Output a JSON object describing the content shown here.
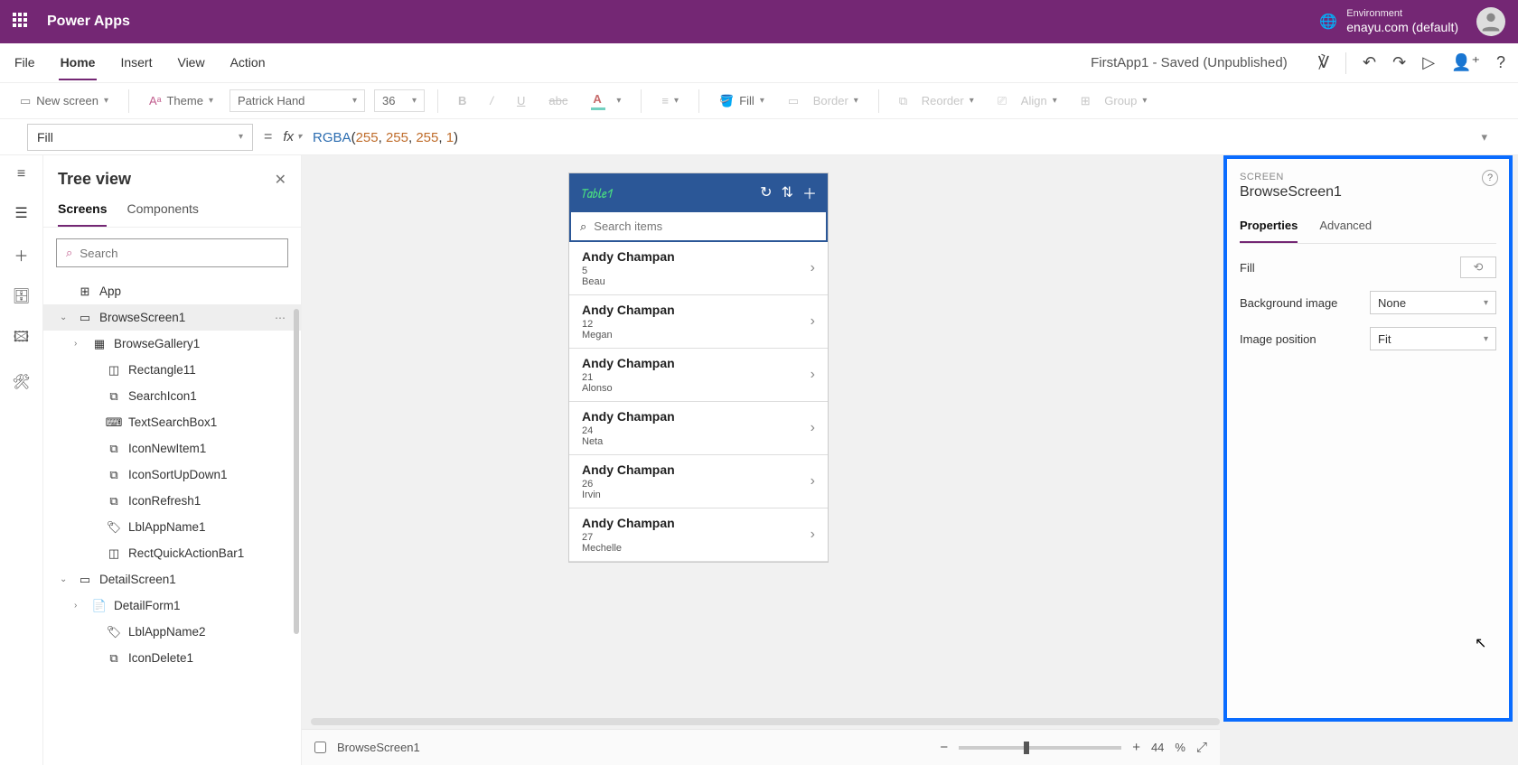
{
  "header": {
    "app": "Power Apps",
    "env_label": "Environment",
    "env_value": "enayu.com (default)"
  },
  "menu": {
    "items": [
      "File",
      "Home",
      "Insert",
      "View",
      "Action"
    ],
    "active": "Home",
    "status": "FirstApp1 - Saved (Unpublished)"
  },
  "ribbon": {
    "new_screen": "New screen",
    "theme": "Theme",
    "font": "Patrick Hand",
    "size": "36",
    "fill": "Fill",
    "border": "Border",
    "reorder": "Reorder",
    "align": "Align",
    "group": "Group"
  },
  "formula": {
    "property": "Fill",
    "fx": "fx",
    "fn": "RGBA",
    "args": [
      "255",
      "255",
      "255",
      "1"
    ]
  },
  "tree": {
    "title": "Tree view",
    "tabs": [
      "Screens",
      "Components"
    ],
    "active_tab": "Screens",
    "search_placeholder": "Search",
    "nodes": [
      {
        "label": "App",
        "level": 0,
        "icon": "app"
      },
      {
        "label": "BrowseScreen1",
        "level": 0,
        "icon": "screen",
        "selected": true,
        "expanded": true,
        "more": true
      },
      {
        "label": "BrowseGallery1",
        "level": 1,
        "icon": "gallery",
        "chev": true
      },
      {
        "label": "Rectangle11",
        "level": 2,
        "icon": "rect"
      },
      {
        "label": "SearchIcon1",
        "level": 2,
        "icon": "ctrl"
      },
      {
        "label": "TextSearchBox1",
        "level": 2,
        "icon": "textbox"
      },
      {
        "label": "IconNewItem1",
        "level": 2,
        "icon": "ctrl"
      },
      {
        "label": "IconSortUpDown1",
        "level": 2,
        "icon": "ctrl"
      },
      {
        "label": "IconRefresh1",
        "level": 2,
        "icon": "ctrl"
      },
      {
        "label": "LblAppName1",
        "level": 2,
        "icon": "label"
      },
      {
        "label": "RectQuickActionBar1",
        "level": 2,
        "icon": "rect"
      },
      {
        "label": "DetailScreen1",
        "level": 0,
        "icon": "screen",
        "expanded": true
      },
      {
        "label": "DetailForm1",
        "level": 1,
        "icon": "form",
        "chev": true
      },
      {
        "label": "LblAppName2",
        "level": 2,
        "icon": "label"
      },
      {
        "label": "IconDelete1",
        "level": 2,
        "icon": "ctrl"
      }
    ]
  },
  "phone": {
    "title": "Table1",
    "search_placeholder": "Search items",
    "rows": [
      {
        "t1": "Andy Champan",
        "t2": "5",
        "t3": "Beau"
      },
      {
        "t1": "Andy Champan",
        "t2": "12",
        "t3": "Megan"
      },
      {
        "t1": "Andy Champan",
        "t2": "21",
        "t3": "Alonso"
      },
      {
        "t1": "Andy Champan",
        "t2": "24",
        "t3": "Neta"
      },
      {
        "t1": "Andy Champan",
        "t2": "26",
        "t3": "Irvin"
      },
      {
        "t1": "Andy Champan",
        "t2": "27",
        "t3": "Mechelle"
      }
    ]
  },
  "props": {
    "type_label": "SCREEN",
    "name": "BrowseScreen1",
    "tabs": [
      "Properties",
      "Advanced"
    ],
    "active_tab": "Properties",
    "fill_label": "Fill",
    "bg_label": "Background image",
    "bg_value": "None",
    "pos_label": "Image position",
    "pos_value": "Fit"
  },
  "status": {
    "screen": "BrowseScreen1",
    "zoom": "44",
    "pct": "%"
  }
}
